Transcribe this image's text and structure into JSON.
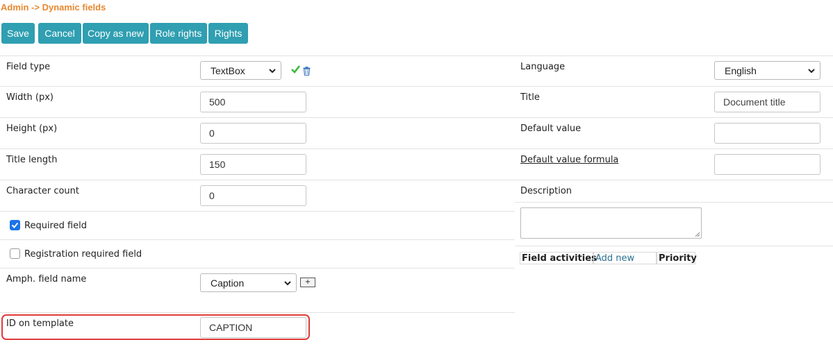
{
  "breadcrumb": "Admin -> Dynamic fields",
  "toolbar": {
    "save": "Save",
    "cancel": "Cancel",
    "copy_as_new": "Copy as new",
    "role_rights": "Role rights",
    "rights": "Rights"
  },
  "left": {
    "field_type": {
      "label": "Field type",
      "value": "TextBox"
    },
    "width": {
      "label": "Width (px)",
      "value": "500"
    },
    "height": {
      "label": "Height (px)",
      "value": "0"
    },
    "title_length": {
      "label": "Title length",
      "value": "150"
    },
    "character_count": {
      "label": "Character count",
      "value": "0"
    },
    "required_field": {
      "label": "Required field",
      "checked": true
    },
    "registration_required": {
      "label": "Registration required field",
      "checked": false
    },
    "amph_field_name": {
      "label": "Amph. field name",
      "value": "Caption",
      "add_label": "+"
    },
    "id_on_template": {
      "label": "ID on template",
      "value": "CAPTION"
    }
  },
  "right": {
    "language": {
      "label": "Language",
      "value": "English"
    },
    "title": {
      "label": "Title",
      "placeholder": "Document title"
    },
    "default_value": {
      "label": "Default value",
      "value": ""
    },
    "default_value_formula": {
      "label": "Default value formula",
      "value": ""
    },
    "description": {
      "label": "Description",
      "value": ""
    },
    "field_activities": {
      "header": "Field activities",
      "add_new": "Add new",
      "priority": "Priority"
    }
  },
  "colors": {
    "accent": "#2f9fb1",
    "breadcrumb": "#e8882e",
    "check_ok": "#3cb93c",
    "trash": "#4a7fc1",
    "highlight": "#e03a3a"
  }
}
